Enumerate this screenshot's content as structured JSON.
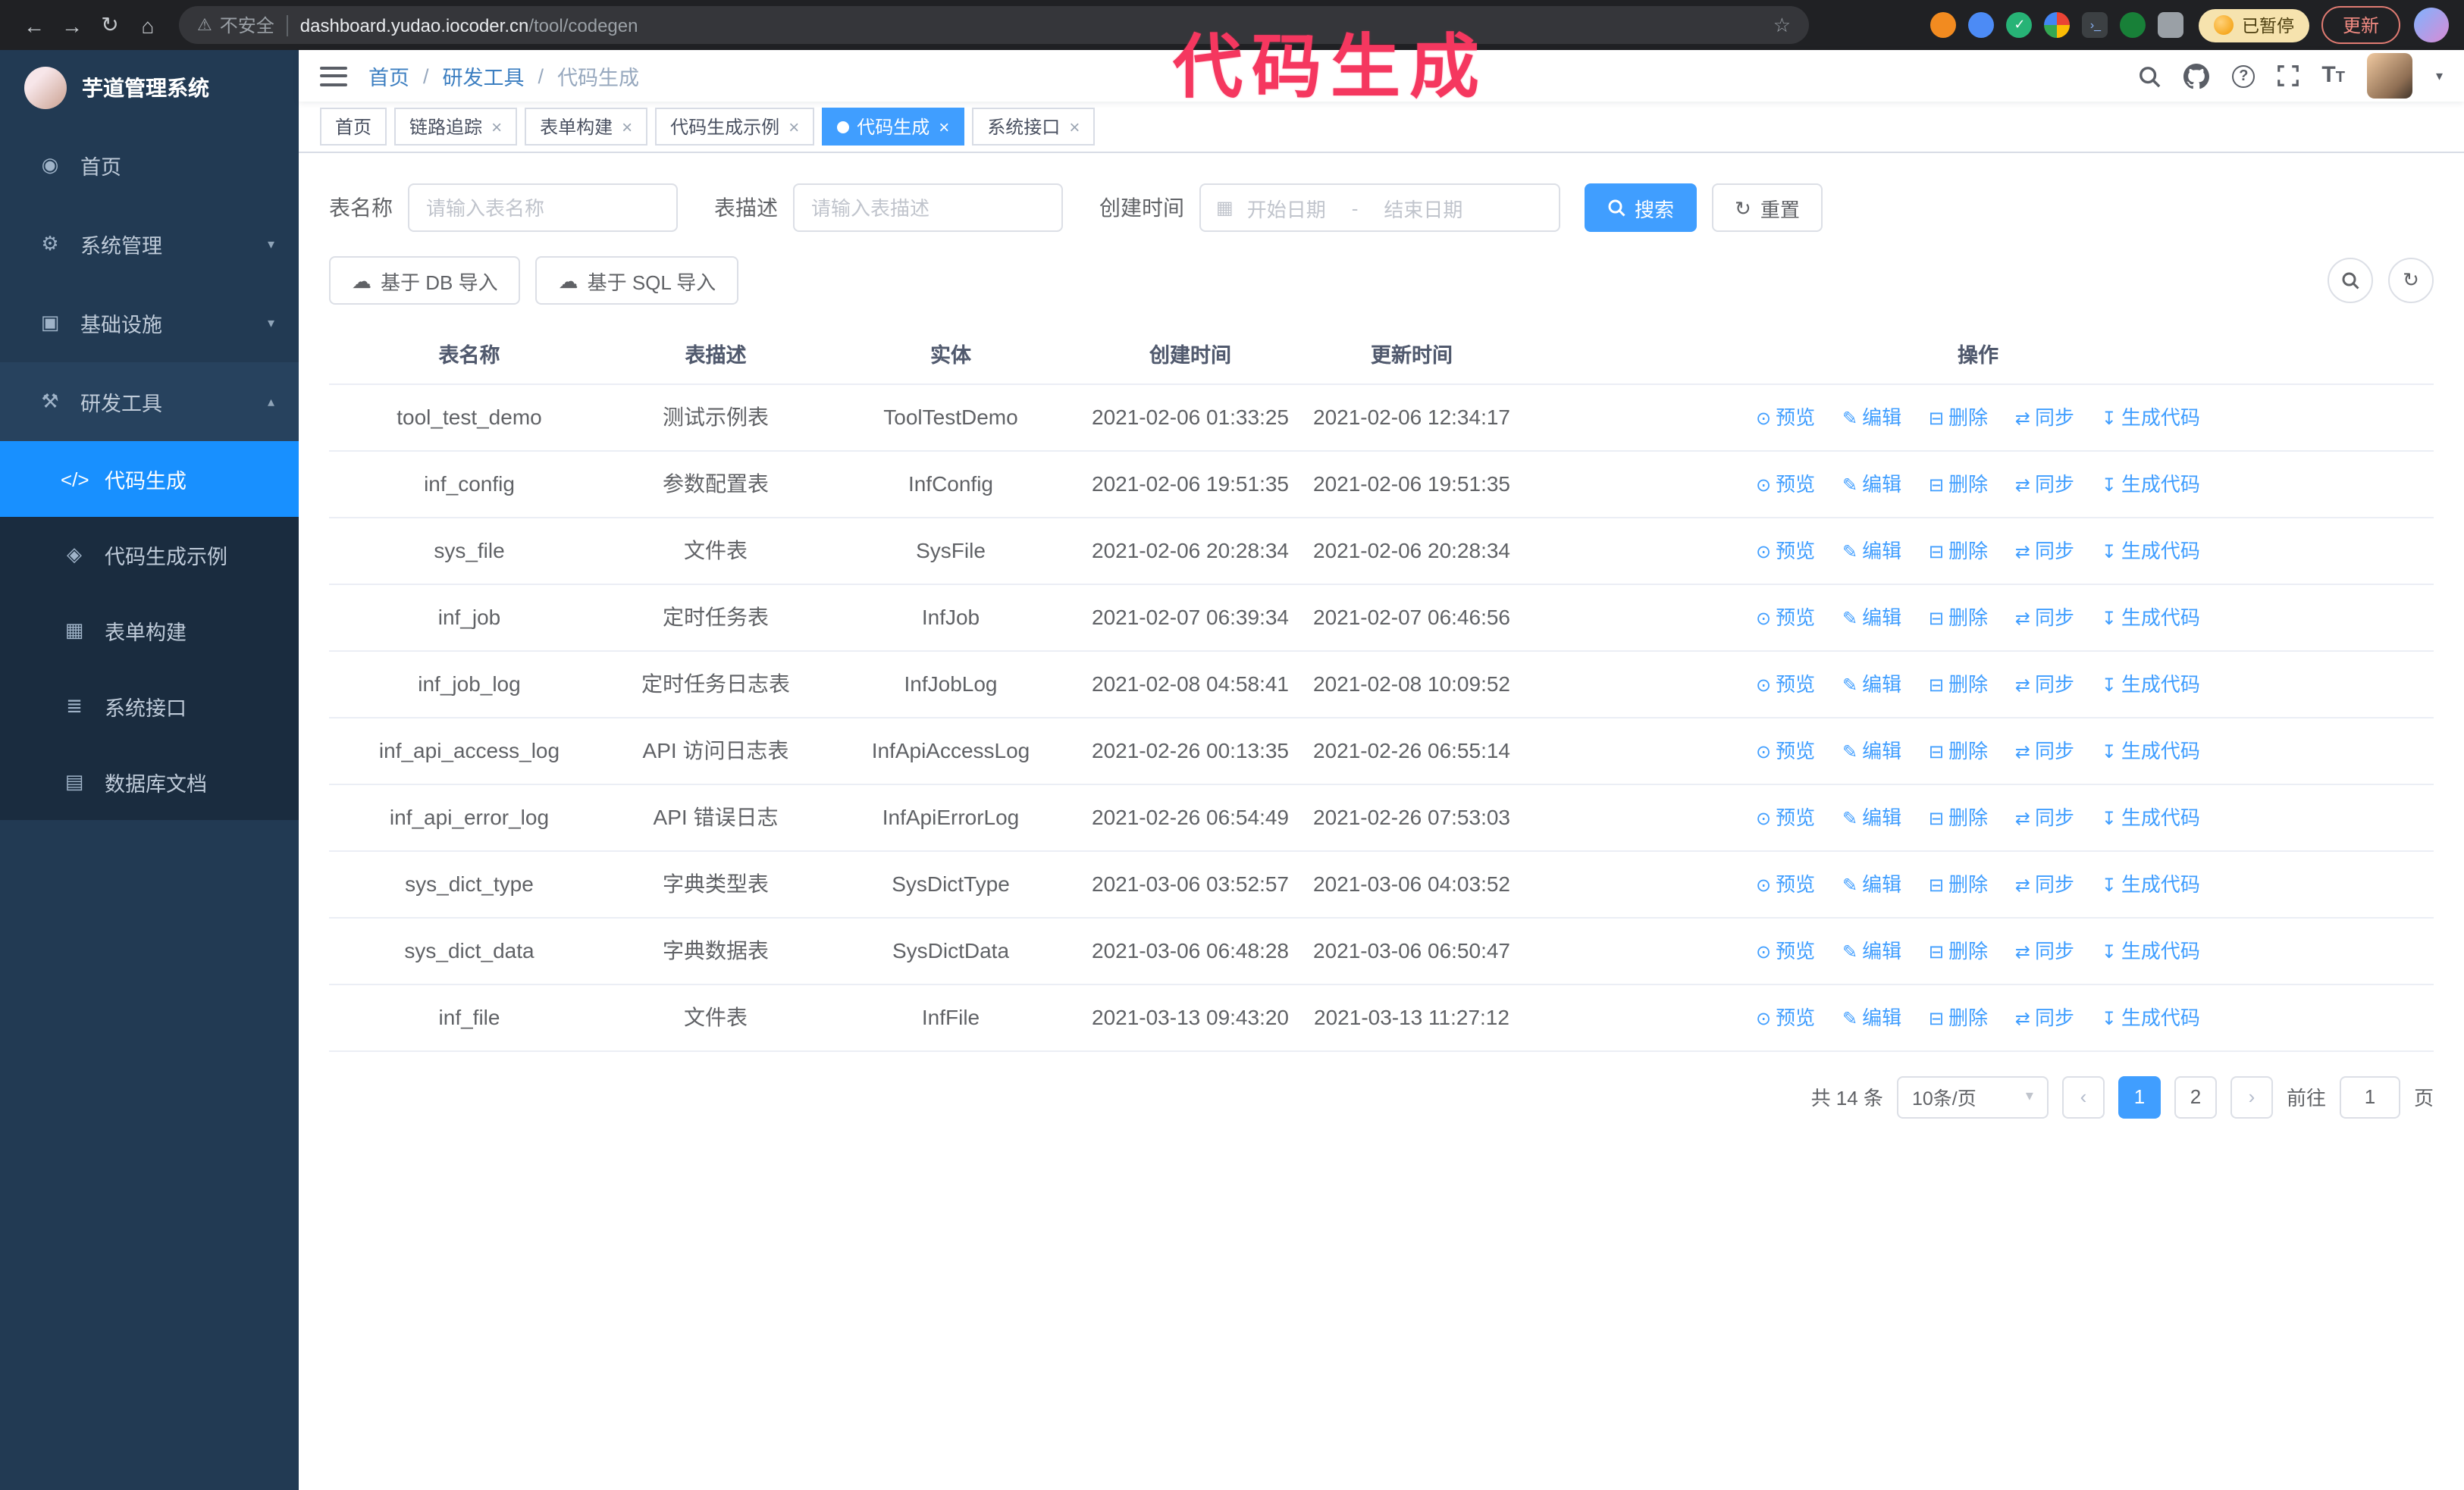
{
  "annotation": {
    "text": "代码生成"
  },
  "colors": {
    "primary": "#409eff",
    "active-blue": "#1890ff",
    "sidebar-bg": "#223a53",
    "submenu-bg": "#1a2c3f",
    "annotation": "#f5375f",
    "chrome-bg": "#202124"
  },
  "icons": {
    "back": "←",
    "forward": "→",
    "refresh": "↻",
    "home": "⌂",
    "warning": "⚠",
    "star": "☆",
    "close": "×",
    "dashboard": "◉",
    "gear": "⚙",
    "infra": "▣",
    "tools": "⚒",
    "code": "</>",
    "example": "◈",
    "form": "▦",
    "api": "≣",
    "database": "▤",
    "chevron_down": "▾",
    "chevron_up": "▴",
    "calendar": "▦",
    "upload": "☁",
    "eye": "⊙",
    "edit": "✎",
    "delete": "⊟",
    "sync": "⇄",
    "generate": "↧",
    "prev": "‹",
    "next": "›",
    "caret_down": "▾",
    "question": "?",
    "check": "✓",
    "terminal": "›_"
  },
  "browser": {
    "warning_text": "不安全",
    "url_host": "dashboard.yudao.iocoder.cn",
    "url_path": "/tool/codegen",
    "paused_badge": "已暂停",
    "update_button": "更新"
  },
  "sidebar": {
    "title": "芋道管理系统",
    "items": [
      {
        "label": "首页"
      },
      {
        "label": "系统管理"
      },
      {
        "label": "基础设施"
      },
      {
        "label": "研发工具"
      }
    ],
    "dev_subitems": [
      {
        "label": "代码生成",
        "active": true
      },
      {
        "label": "代码生成示例"
      },
      {
        "label": "表单构建"
      },
      {
        "label": "系统接口"
      },
      {
        "label": "数据库文档"
      }
    ]
  },
  "header": {
    "breadcrumb": [
      "首页",
      "研发工具",
      "代码生成"
    ],
    "separator": "/"
  },
  "tabs": [
    {
      "label": "首页",
      "closable": false,
      "active": false
    },
    {
      "label": "链路追踪",
      "closable": true,
      "active": false
    },
    {
      "label": "表单构建",
      "closable": true,
      "active": false
    },
    {
      "label": "代码生成示例",
      "closable": true,
      "active": false
    },
    {
      "label": "代码生成",
      "closable": true,
      "active": true
    },
    {
      "label": "系统接口",
      "closable": true,
      "active": false
    }
  ],
  "filters": {
    "table_name_label": "表名称",
    "table_name_placeholder": "请输入表名称",
    "table_desc_label": "表描述",
    "table_desc_placeholder": "请输入表描述",
    "create_time_label": "创建时间",
    "date_start_placeholder": "开始日期",
    "date_separator": "-",
    "date_end_placeholder": "结束日期",
    "search_button": "搜索",
    "reset_button": "重置"
  },
  "toolbar": {
    "import_db": "基于 DB 导入",
    "import_sql": "基于 SQL 导入"
  },
  "table": {
    "columns": [
      "表名称",
      "表描述",
      "实体",
      "创建时间",
      "更新时间",
      "操作"
    ],
    "actions": [
      "预览",
      "编辑",
      "删除",
      "同步",
      "生成代码"
    ],
    "rows": [
      {
        "name": "tool_test_demo",
        "desc": "测试示例表",
        "entity": "ToolTestDemo",
        "created": "2021-02-06 01:33:25",
        "updated": "2021-02-06 12:34:17"
      },
      {
        "name": "inf_config",
        "desc": "参数配置表",
        "entity": "InfConfig",
        "created": "2021-02-06 19:51:35",
        "updated": "2021-02-06 19:51:35"
      },
      {
        "name": "sys_file",
        "desc": "文件表",
        "entity": "SysFile",
        "created": "2021-02-06 20:28:34",
        "updated": "2021-02-06 20:28:34"
      },
      {
        "name": "inf_job",
        "desc": "定时任务表",
        "entity": "InfJob",
        "created": "2021-02-07 06:39:34",
        "updated": "2021-02-07 06:46:56"
      },
      {
        "name": "inf_job_log",
        "desc": "定时任务日志表",
        "entity": "InfJobLog",
        "created": "2021-02-08 04:58:41",
        "updated": "2021-02-08 10:09:52"
      },
      {
        "name": "inf_api_access_log",
        "desc": "API 访问日志表",
        "entity": "InfApiAccessLog",
        "created": "2021-02-26 00:13:35",
        "updated": "2021-02-26 06:55:14"
      },
      {
        "name": "inf_api_error_log",
        "desc": "API 错误日志",
        "entity": "InfApiErrorLog",
        "created": "2021-02-26 06:54:49",
        "updated": "2021-02-26 07:53:03"
      },
      {
        "name": "sys_dict_type",
        "desc": "字典类型表",
        "entity": "SysDictType",
        "created": "2021-03-06 03:52:57",
        "updated": "2021-03-06 04:03:52"
      },
      {
        "name": "sys_dict_data",
        "desc": "字典数据表",
        "entity": "SysDictData",
        "created": "2021-03-06 06:48:28",
        "updated": "2021-03-06 06:50:47"
      },
      {
        "name": "inf_file",
        "desc": "文件表",
        "entity": "InfFile",
        "created": "2021-03-13 09:43:20",
        "updated": "2021-03-13 11:27:12"
      }
    ]
  },
  "pagination": {
    "total": "共 14 条",
    "page_size": "10条/页",
    "pages": [
      "1",
      "2"
    ],
    "goto_prefix": "前往",
    "goto_value": "1",
    "goto_suffix": "页"
  }
}
